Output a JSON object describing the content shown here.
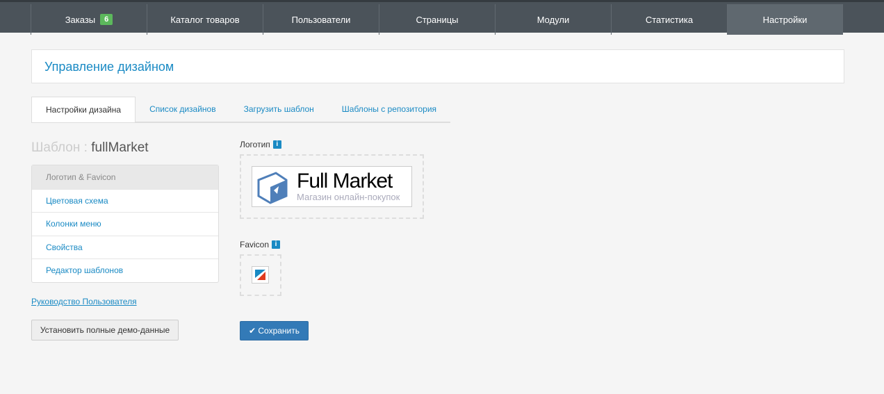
{
  "nav": {
    "items": [
      {
        "label": "Заказы",
        "badge": "6"
      },
      {
        "label": "Каталог товаров"
      },
      {
        "label": "Пользователи"
      },
      {
        "label": "Страницы"
      },
      {
        "label": "Модули"
      },
      {
        "label": "Статистика"
      },
      {
        "label": "Настройки"
      }
    ]
  },
  "header": {
    "title": "Управление дизайном"
  },
  "tabs": [
    "Настройки дизайна",
    "Список дизайнов",
    "Загрузить шаблон",
    "Шаблоны с репозитория"
  ],
  "template": {
    "label": "Шаблон :",
    "name": "fullMarket"
  },
  "menu": [
    "Логотип & Favicon",
    "Цветовая схема",
    "Колонки меню",
    "Свойства",
    "Редактор шаблонов"
  ],
  "guide_link": "Руководство Пользователя",
  "demo_button": "Установить полные демо-данные",
  "logo": {
    "label": "Логотип",
    "title": "Full Market",
    "subtitle": "Магазин онлайн-покупок"
  },
  "favicon": {
    "label": "Favicon"
  },
  "save_button": "Сохранить"
}
